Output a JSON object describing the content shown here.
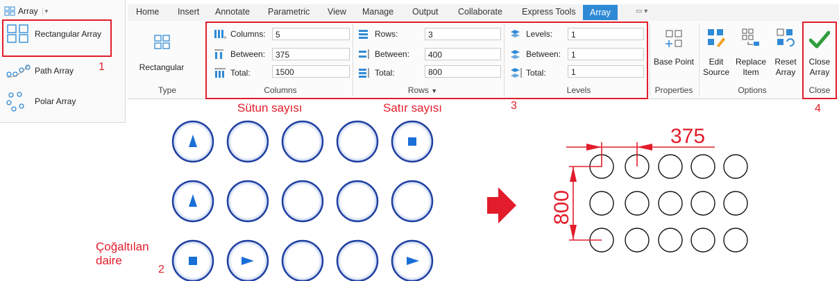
{
  "left_panel": {
    "dropdown_label": "Array",
    "items": [
      {
        "label": "Rectangular Array"
      },
      {
        "label": "Path Array"
      },
      {
        "label": "Polar Array"
      }
    ]
  },
  "tabs": [
    "Home",
    "Insert",
    "Annotate",
    "Parametric",
    "View",
    "Manage",
    "Output",
    "Collaborate",
    "Express Tools",
    "Array"
  ],
  "ribbon": {
    "type_group": {
      "button_label": "Rectangular",
      "group_label": "Type"
    },
    "columns_group": {
      "group_label": "Columns",
      "columns": {
        "label": "Columns:",
        "value": "5"
      },
      "between": {
        "label": "Between:",
        "value": "375"
      },
      "total": {
        "label": "Total:",
        "value": "1500"
      }
    },
    "rows_group": {
      "group_label": "Rows",
      "rows": {
        "label": "Rows:",
        "value": "3"
      },
      "between": {
        "label": "Between:",
        "value": "400"
      },
      "total": {
        "label": "Total:",
        "value": "800"
      }
    },
    "levels_group": {
      "group_label": "Levels",
      "levels": {
        "label": "Levels:",
        "value": "1"
      },
      "between": {
        "label": "Between:",
        "value": "1"
      },
      "total": {
        "label": "Total:",
        "value": "1"
      }
    },
    "properties_group": {
      "button_label": "Base Point",
      "group_label": "Properties"
    },
    "options_group": {
      "group_label": "Options",
      "edit_source": [
        "Edit",
        "Source"
      ],
      "replace_item": [
        "Replace",
        "Item"
      ],
      "reset_array": [
        "Reset",
        "Array"
      ]
    },
    "close_group": {
      "button_label": [
        "Close",
        "Array"
      ],
      "group_label": "Close"
    }
  },
  "annotations": {
    "num1": "1",
    "num2": "2",
    "num3": "3",
    "num4": "4",
    "sutun": "Sütun sayısı",
    "satir": "Satır sayısı",
    "cogaltilan": "Çoğaltılan",
    "daire": "daire",
    "dim_h": "375",
    "dim_v": "800"
  },
  "colors": {
    "accent": "#2f8ad6",
    "annotation_red": "#e21c2a",
    "circle_blue": "#1f3fa0",
    "check_green": "#2e9e3b"
  }
}
